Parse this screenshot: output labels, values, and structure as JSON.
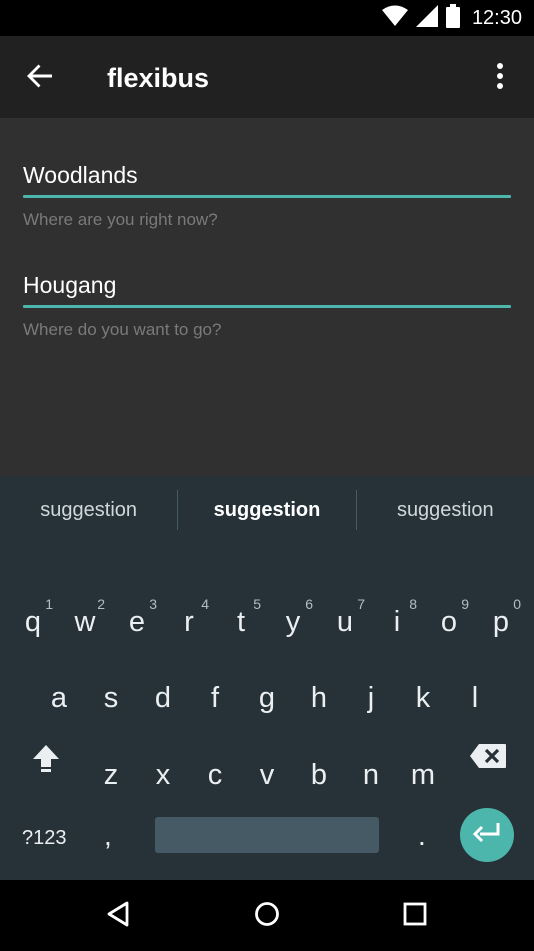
{
  "status": {
    "time": "12:30",
    "icons": [
      "wifi-icon",
      "signal-icon",
      "battery-icon"
    ]
  },
  "app_bar": {
    "title": "flexibus",
    "back_icon": "arrow-back-icon",
    "menu_icon": "more-vert-icon"
  },
  "form": {
    "origin": {
      "value": "Woodlands",
      "hint": "Where are you right now?"
    },
    "destination": {
      "value": "Hougang",
      "hint": "Where do you want to go?"
    }
  },
  "suggestions": [
    "suggestion",
    "suggestion",
    "suggestion"
  ],
  "keyboard": {
    "row1": [
      {
        "char": "q",
        "hint": "1"
      },
      {
        "char": "w",
        "hint": "2"
      },
      {
        "char": "e",
        "hint": "3"
      },
      {
        "char": "r",
        "hint": "4"
      },
      {
        "char": "t",
        "hint": "5"
      },
      {
        "char": "y",
        "hint": "6"
      },
      {
        "char": "u",
        "hint": "7"
      },
      {
        "char": "i",
        "hint": "8"
      },
      {
        "char": "o",
        "hint": "9"
      },
      {
        "char": "p",
        "hint": "0"
      }
    ],
    "row2": [
      "a",
      "s",
      "d",
      "f",
      "g",
      "h",
      "j",
      "k",
      "l"
    ],
    "row3": [
      "z",
      "x",
      "c",
      "v",
      "b",
      "n",
      "m"
    ],
    "symbols_label": "?123",
    "comma": ",",
    "period": ".",
    "accent_color": "#4db6ac"
  },
  "nav": {
    "icons": [
      "back-triangle-icon",
      "home-circle-icon",
      "recents-square-icon"
    ]
  }
}
